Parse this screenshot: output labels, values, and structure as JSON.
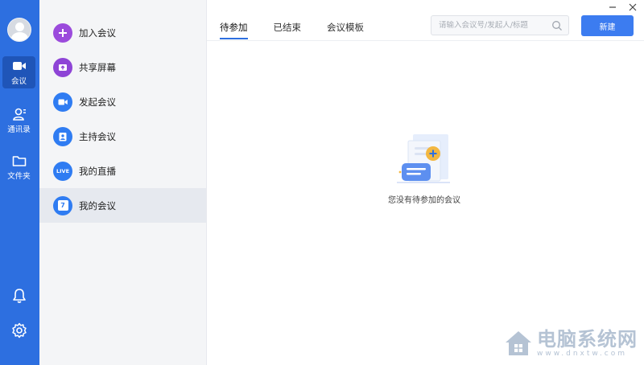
{
  "rail": {
    "items": [
      {
        "label": "会议",
        "icon": "video-camera-icon"
      },
      {
        "label": "通讯录",
        "icon": "contacts-icon"
      },
      {
        "label": "文件夹",
        "icon": "folder-icon"
      }
    ],
    "bottom_icons": [
      "bell-icon",
      "settings-icon"
    ]
  },
  "menu": {
    "items": [
      {
        "label": "加入会议",
        "icon": "plus-icon",
        "color": "#9b4bdc"
      },
      {
        "label": "共享屏幕",
        "icon": "share-screen-icon",
        "color": "#8e44d6"
      },
      {
        "label": "发起会议",
        "icon": "video-camera-icon",
        "color": "#2f7cf2"
      },
      {
        "label": "主持会议",
        "icon": "host-icon",
        "color": "#2f7cf2"
      },
      {
        "label": "我的直播",
        "icon": "live-icon",
        "badge": "LIVE",
        "color": "#2f7cf2"
      },
      {
        "label": "我的会议",
        "icon": "calendar-icon",
        "badge": "7",
        "color": "#2f7cf2"
      }
    ],
    "active_index": 5
  },
  "tabs": [
    "待参加",
    "已结束",
    "会议模板"
  ],
  "active_tab": 0,
  "search": {
    "placeholder": "请输入会议号/发起人/标题",
    "value": ""
  },
  "new_button": "新建",
  "window_controls": [
    "minimize-icon",
    "close-icon"
  ],
  "empty_state": {
    "text": "您没有待参加的会议"
  },
  "watermark": {
    "title": "电脑系统网",
    "url": "www.dnxtw.com"
  },
  "colors": {
    "accent": "#2d6fe0",
    "button": "#3c7cf0",
    "purple": "#9b4bdc"
  }
}
